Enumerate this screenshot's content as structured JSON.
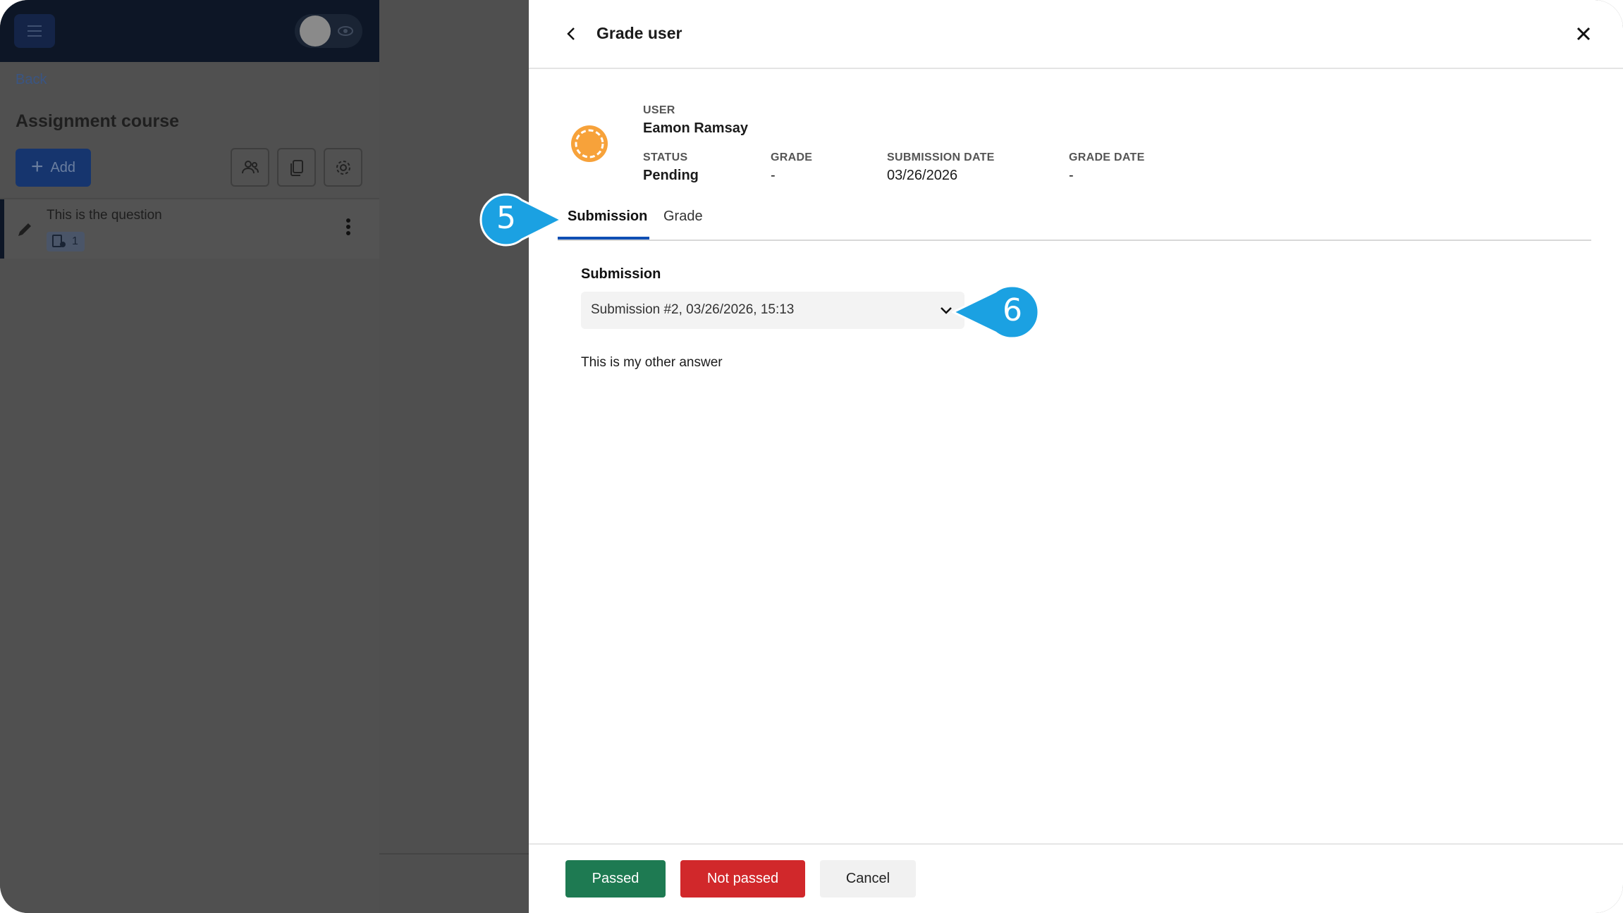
{
  "left_app": {
    "back_label": "Back",
    "course_title": "Assignment course",
    "add_label": "Add",
    "question": {
      "text": "This is the question",
      "submission_count": "1"
    }
  },
  "panel": {
    "title": "Grade user",
    "user": {
      "user_label": "USER",
      "user_name": "Eamon Ramsay",
      "status_label": "STATUS",
      "status_value": "Pending",
      "grade_label": "GRADE",
      "grade_value": "-",
      "submission_date_label": "SUBMISSION DATE",
      "submission_date_value": "03/26/2026",
      "grade_date_label": "GRADE DATE",
      "grade_date_value": "-"
    },
    "tabs": [
      {
        "label": "Submission",
        "active": true
      },
      {
        "label": "Grade",
        "active": false
      }
    ],
    "submission": {
      "section_label": "Submission",
      "selected": "Submission #2, 03/26/2026, 15:13",
      "answer": "This is my other answer"
    },
    "footer": {
      "passed_label": "Passed",
      "not_passed_label": "Not passed",
      "cancel_label": "Cancel"
    }
  },
  "callouts": [
    {
      "number": "5",
      "points_to": "tab-submission"
    },
    {
      "number": "6",
      "points_to": "submission-select"
    }
  ],
  "colors": {
    "accent": "#0f4fb4",
    "passed": "#1e7a52",
    "not_passed": "#d1282b",
    "callout": "#1ba1e2",
    "avatar_ring": "#f7a23a"
  }
}
